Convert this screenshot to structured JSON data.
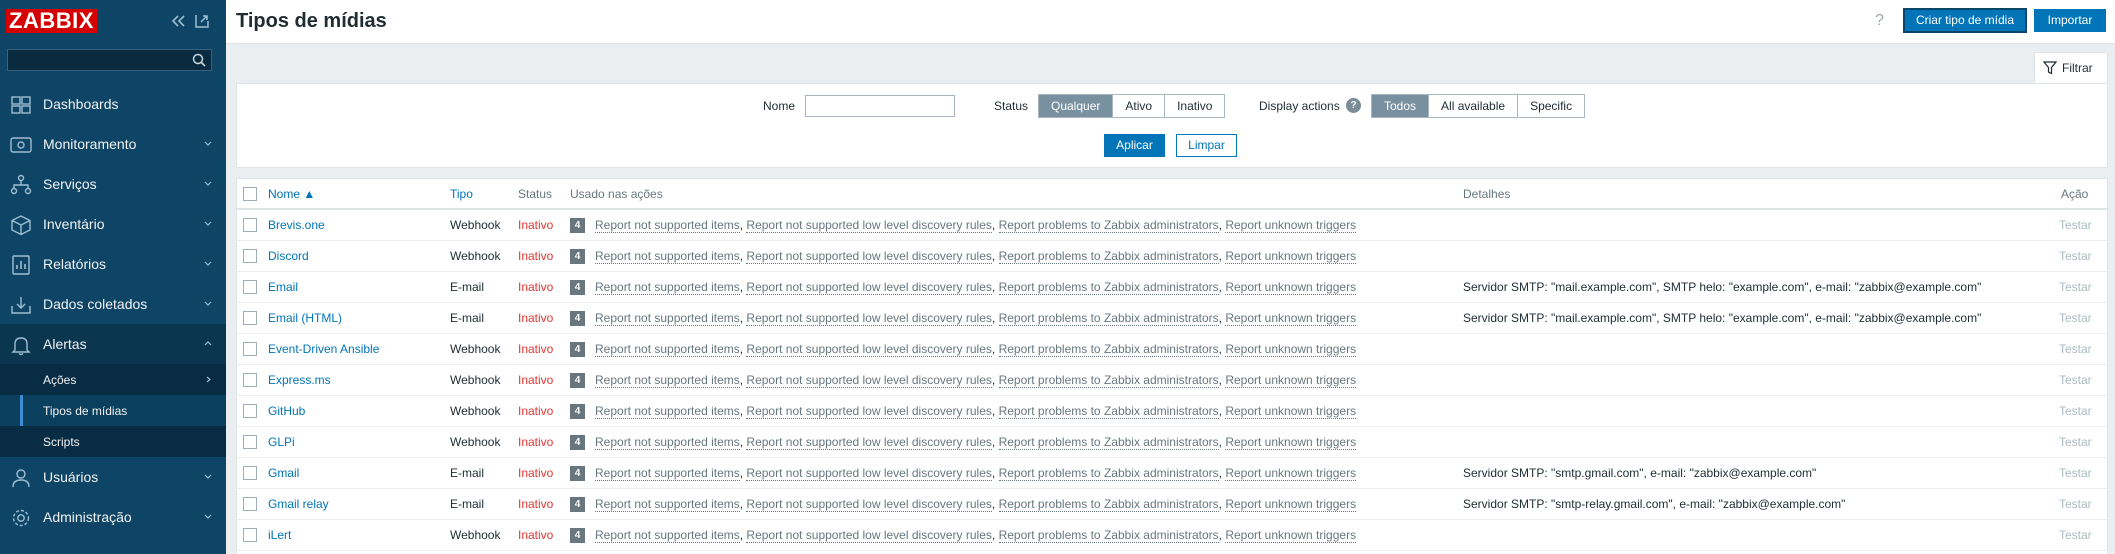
{
  "app": {
    "logo": "ZABBIX"
  },
  "sidebar": {
    "search_placeholder": "",
    "menu": [
      {
        "label": "Dashboards"
      },
      {
        "label": "Monitoramento"
      },
      {
        "label": "Serviços"
      },
      {
        "label": "Inventário"
      },
      {
        "label": "Relatórios"
      },
      {
        "label": "Dados coletados"
      },
      {
        "label": "Alertas"
      },
      {
        "label": "Usuários"
      },
      {
        "label": "Administração"
      }
    ],
    "alerts_submenu": [
      {
        "label": "Ações"
      },
      {
        "label": "Tipos de mídias"
      },
      {
        "label": "Scripts"
      }
    ]
  },
  "header": {
    "title": "Tipos de mídias",
    "help": "?",
    "create_label": "Criar tipo de mídia",
    "import_label": "Importar"
  },
  "filter": {
    "tab_label": "Filtrar",
    "name_label": "Nome",
    "name_value": "",
    "status_label": "Status",
    "status_options": [
      "Qualquer",
      "Ativo",
      "Inativo"
    ],
    "status_selected": "Qualquer",
    "display_actions_label": "Display actions",
    "display_actions_help": "?",
    "display_options": [
      "Todos",
      "All available",
      "Specific"
    ],
    "display_selected": "Todos",
    "apply_label": "Aplicar",
    "reset_label": "Limpar"
  },
  "table": {
    "columns": {
      "name": "Nome ▲",
      "type": "Tipo",
      "status": "Status",
      "used_in_actions": "Usado nas ações",
      "details": "Detalhes",
      "action": "Ação"
    },
    "rows": [
      {
        "name": "Brevis.one",
        "type": "Webhook",
        "status": "Inativo",
        "count": "4",
        "details": "",
        "test": "Testar"
      },
      {
        "name": "Discord",
        "type": "Webhook",
        "status": "Inativo",
        "count": "4",
        "details": "",
        "test": "Testar"
      },
      {
        "name": "Email",
        "type": "E-mail",
        "status": "Inativo",
        "count": "4",
        "details": "Servidor SMTP: \"mail.example.com\", SMTP helo: \"example.com\", e-mail: \"zabbix@example.com\"",
        "test": "Testar"
      },
      {
        "name": "Email (HTML)",
        "type": "E-mail",
        "status": "Inativo",
        "count": "4",
        "details": "Servidor SMTP: \"mail.example.com\", SMTP helo: \"example.com\", e-mail: \"zabbix@example.com\"",
        "test": "Testar"
      },
      {
        "name": "Event-Driven Ansible",
        "type": "Webhook",
        "status": "Inativo",
        "count": "4",
        "details": "",
        "test": "Testar"
      },
      {
        "name": "Express.ms",
        "type": "Webhook",
        "status": "Inativo",
        "count": "4",
        "details": "",
        "test": "Testar"
      },
      {
        "name": "GitHub",
        "type": "Webhook",
        "status": "Inativo",
        "count": "4",
        "details": "",
        "test": "Testar"
      },
      {
        "name": "GLPi",
        "type": "Webhook",
        "status": "Inativo",
        "count": "4",
        "details": "",
        "test": "Testar"
      },
      {
        "name": "Gmail",
        "type": "E-mail",
        "status": "Inativo",
        "count": "4",
        "details": "Servidor SMTP: \"smtp.gmail.com\", e-mail: \"zabbix@example.com\"",
        "test": "Testar"
      },
      {
        "name": "Gmail relay",
        "type": "E-mail",
        "status": "Inativo",
        "count": "4",
        "details": "Servidor SMTP: \"smtp-relay.gmail.com\", e-mail: \"zabbix@example.com\"",
        "test": "Testar"
      },
      {
        "name": "iLert",
        "type": "Webhook",
        "status": "Inativo",
        "count": "4",
        "details": "",
        "test": "Testar"
      }
    ],
    "actions": [
      "Report not supported items",
      "Report not supported low level discovery rules",
      "Report problems to Zabbix administrators",
      "Report unknown triggers"
    ],
    "separator": ", "
  },
  "colors": {
    "sidebar_bg": "#0e4566",
    "accent": "#0275b8",
    "status_inactive": "#e33734",
    "logo_bg": "#d40000"
  }
}
